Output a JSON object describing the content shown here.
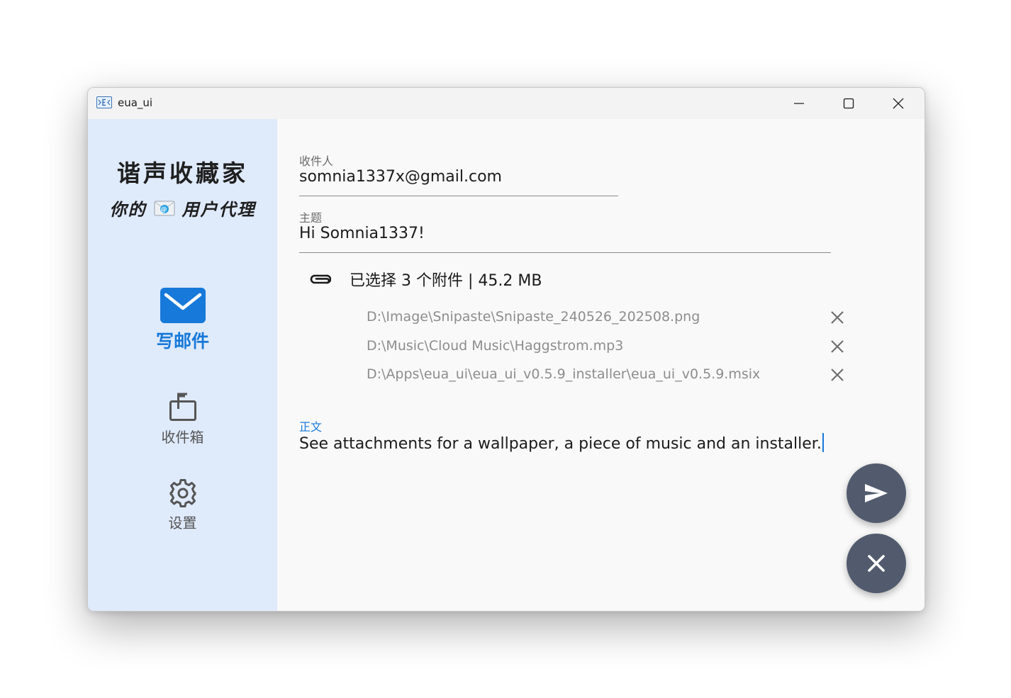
{
  "window": {
    "title": "eua_ui",
    "app_icon": "mail-arrows-icon",
    "controls": [
      "minimize-icon",
      "maximize-icon",
      "close-icon"
    ]
  },
  "sidebar": {
    "brand_title": "谐声收藏家",
    "brand_sub_prefix": "你的",
    "brand_sub_suffix": "用户代理",
    "brand_sub_icon": "envelope-emoji-icon",
    "nav": [
      {
        "label": "写邮件",
        "icon": "mail-icon",
        "active": true
      },
      {
        "label": "收件箱",
        "icon": "inbox-icon",
        "active": false
      },
      {
        "label": "设置",
        "icon": "gear-icon",
        "active": false
      }
    ]
  },
  "compose": {
    "to_label": "收件人",
    "to_value": "somnia1337x@gmail.com",
    "subject_label": "主题",
    "subject_value": "Hi Somnia1337!",
    "attachments_summary": "已选择 3 个附件 | 45.2 MB",
    "attachments": [
      {
        "path": "D:\\Image\\Snipaste\\Snipaste_240526_202508.png"
      },
      {
        "path": "D:\\Music\\Cloud Music\\Haggstrom.mp3"
      },
      {
        "path": "D:\\Apps\\eua_ui\\eua_ui_v0.5.9_installer\\eua_ui_v0.5.9.msix"
      }
    ],
    "body_label": "正文",
    "body_value": "See attachments for a wallpaper, a piece of music and an installer."
  },
  "actions": {
    "send_icon": "send-icon",
    "cancel_icon": "close-icon"
  },
  "colors": {
    "accent": "#1779d9",
    "sidebar_bg": "#dfeafb",
    "fab_bg": "#525b6e"
  }
}
